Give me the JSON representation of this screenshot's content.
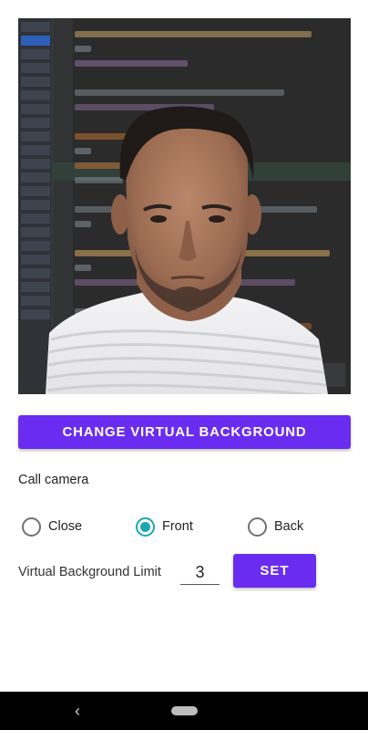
{
  "preview": {
    "background_scene": "code-editor-screenshot",
    "subject": "person-portrait"
  },
  "actions": {
    "change_background_label": "CHANGE VIRTUAL BACKGROUND"
  },
  "call_camera": {
    "label": "Call camera",
    "options": [
      {
        "label": "Close",
        "checked": false
      },
      {
        "label": "Front",
        "checked": true
      },
      {
        "label": "Back",
        "checked": false
      }
    ]
  },
  "limit": {
    "label": "Virtual Background Limit",
    "value": "3",
    "set_label": "SET"
  },
  "colors": {
    "primary": "#6a2cf0",
    "radio_checked": "#1aa6b7"
  },
  "navigation": {
    "back_icon": "chevron-left-icon",
    "home_icon": "home-pill-icon"
  }
}
